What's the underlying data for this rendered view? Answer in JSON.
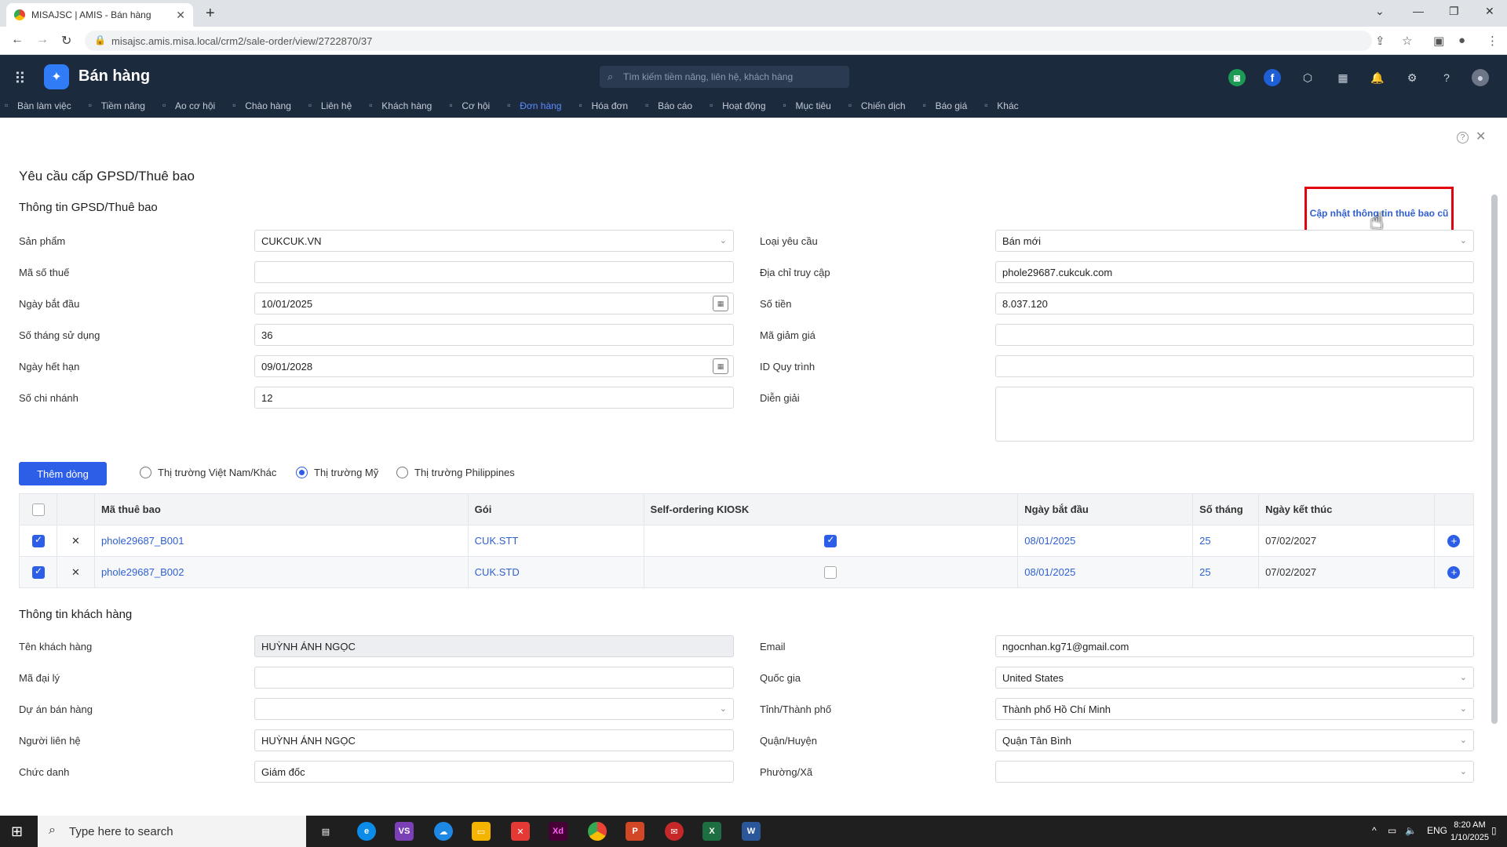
{
  "browser": {
    "tab_title": "MISAJSC | AMIS - Bán hàng",
    "url": "misajsc.amis.misa.local/crm2/sale-order/view/2722870/37"
  },
  "app": {
    "name": "Bán hàng",
    "search_placeholder": "Tìm kiếm tiềm năng, liên hệ, khách hàng",
    "menu": [
      "Bàn làm việc",
      "Tiềm năng",
      "Ao cơ hội",
      "Chào hàng",
      "Liên hệ",
      "Khách hàng",
      "Cơ hội",
      "Đơn hàng",
      "Hóa đơn",
      "Báo cáo",
      "Hoạt động",
      "Mục tiêu",
      "Chiến dịch",
      "Báo giá",
      "Khác"
    ]
  },
  "form": {
    "title": "Yêu cầu cấp GPSD/Thuê bao",
    "section1": "Thông tin GPSD/Thuê bao",
    "update_link": "Cập nhật thông tin thuê bao cũ",
    "left": [
      {
        "label": "Sản phẩm",
        "value": "CUKCUK.VN"
      },
      {
        "label": "Mã số thuế",
        "value": ""
      },
      {
        "label": "Ngày bắt đầu",
        "value": "10/01/2025"
      },
      {
        "label": "Số tháng sử dụng",
        "value": "36"
      },
      {
        "label": "Ngày hết hạn",
        "value": "09/01/2028"
      },
      {
        "label": "Số chi nhánh",
        "value": "12"
      }
    ],
    "right": [
      {
        "label": "Loại yêu cầu",
        "value": "Bán mới"
      },
      {
        "label": "Địa chỉ truy cập",
        "value": "phole29687.cukcuk.com"
      },
      {
        "label": "Số tiền",
        "value": "8.037.120"
      },
      {
        "label": "Mã giảm giá",
        "value": ""
      },
      {
        "label": "ID Quy trình",
        "value": ""
      },
      {
        "label": "Diễn giải",
        "value": ""
      }
    ],
    "add_row_button": "Thêm dòng",
    "markets": [
      "Thị trường Việt Nam/Khác",
      "Thị trường Mỹ",
      "Thị trường Philippines"
    ],
    "table": {
      "headers": [
        "Mã thuê bao",
        "Gói",
        "Self-ordering KIOSK",
        "Ngày bắt đầu",
        "Số tháng",
        "Ngày kết thúc"
      ],
      "rows": [
        {
          "code": "phole29687_B001",
          "package": "CUK.STT",
          "start": "08/01/2025",
          "months": "25",
          "end": "07/02/2027"
        },
        {
          "code": "phole29687_B002",
          "package": "CUK.STD",
          "start": "08/01/2025",
          "months": "25",
          "end": "07/02/2027"
        }
      ]
    },
    "section2": "Thông tin khách hàng",
    "cust_left": [
      {
        "label": "Tên khách hàng",
        "value": "HUỲNH ÁNH NGỌC"
      },
      {
        "label": "Mã đại lý",
        "value": ""
      },
      {
        "label": "Dự án bán hàng",
        "value": ""
      },
      {
        "label": "Người liên hệ",
        "value": "HUỲNH ÁNH NGỌC"
      },
      {
        "label": "Chức danh",
        "value": "Giám đốc"
      }
    ],
    "cust_right": [
      {
        "label": "Email",
        "value": "ngocnhan.kg71@gmail.com"
      },
      {
        "label": "Quốc gia",
        "value": "United States"
      },
      {
        "label": "Tỉnh/Thành phố",
        "value": "Thành phố Hồ Chí Minh"
      },
      {
        "label": "Quận/Huyện",
        "value": "Quận Tân Bình"
      },
      {
        "label": "Phường/Xã",
        "value": ""
      }
    ]
  },
  "taskbar": {
    "search": "Type here to search",
    "lang": "ENG",
    "time": "8:20 AM",
    "date": "1/10/2025"
  }
}
